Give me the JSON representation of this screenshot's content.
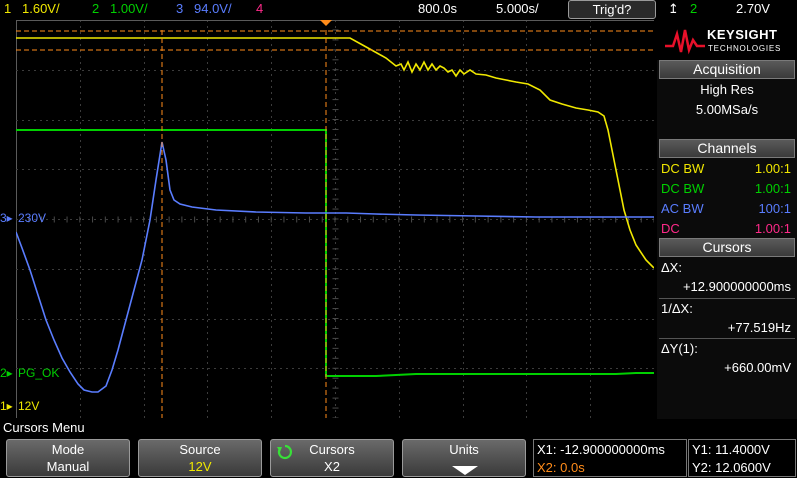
{
  "top": {
    "ch1_num": "1",
    "ch1_scale": "1.60V/",
    "ch2_num": "2",
    "ch2_scale": "1.00V/",
    "ch3_num": "3",
    "ch3_scale": "94.0V/",
    "ch4_num": "4",
    "time_scale": "800.0s",
    "sample_rate": "5.000s/",
    "trigger_status": "Trig'd?",
    "trig_source": "2",
    "trig_level": "2.70V"
  },
  "markers": {
    "ch3_label": "230V",
    "ch2_label": "PG_OK",
    "ch1_label": "12V"
  },
  "brand": {
    "name": "KEYSIGHT",
    "sub": "TECHNOLOGIES"
  },
  "acquisition": {
    "title": "Acquisition",
    "mode": "High Res",
    "rate": "5.00MSa/s"
  },
  "channels": {
    "title": "Channels",
    "rows": [
      {
        "coupling": "DC BW",
        "probe": "1.00:1",
        "color": "#f0e800"
      },
      {
        "coupling": "DC BW",
        "probe": "1.00:1",
        "color": "#00d000"
      },
      {
        "coupling": "AC BW",
        "probe": "100:1",
        "color": "#5a7dff"
      },
      {
        "coupling": "DC",
        "probe": "1.00:1",
        "color": "#ff2a8a"
      }
    ]
  },
  "cursors_panel": {
    "title": "Cursors",
    "dx_label": "ΔX:",
    "dx_value": "+12.900000000ms",
    "inv_dx_label": "1/ΔX:",
    "inv_dx_value": "+77.519Hz",
    "dy_label": "ΔY(1):",
    "dy_value": "+660.00mV"
  },
  "menu": {
    "title": "Cursors Menu",
    "keys": [
      {
        "title": "Mode",
        "value": "Manual"
      },
      {
        "title": "Source",
        "value": "12V"
      },
      {
        "title": "Cursors",
        "value": "X2"
      },
      {
        "title": "Units",
        "value": ""
      }
    ]
  },
  "readout": {
    "x1": "X1: -12.900000000ms",
    "x2": "X2: 0.0s",
    "y1": "Y1: 11.4000V",
    "y2": "Y2: 12.0600V"
  },
  "colors": {
    "ch1": "#f0e800",
    "ch2": "#00d000",
    "ch3": "#5a7dff",
    "ch4": "#ff2a8a",
    "cursor": "#ff8c1a"
  }
}
